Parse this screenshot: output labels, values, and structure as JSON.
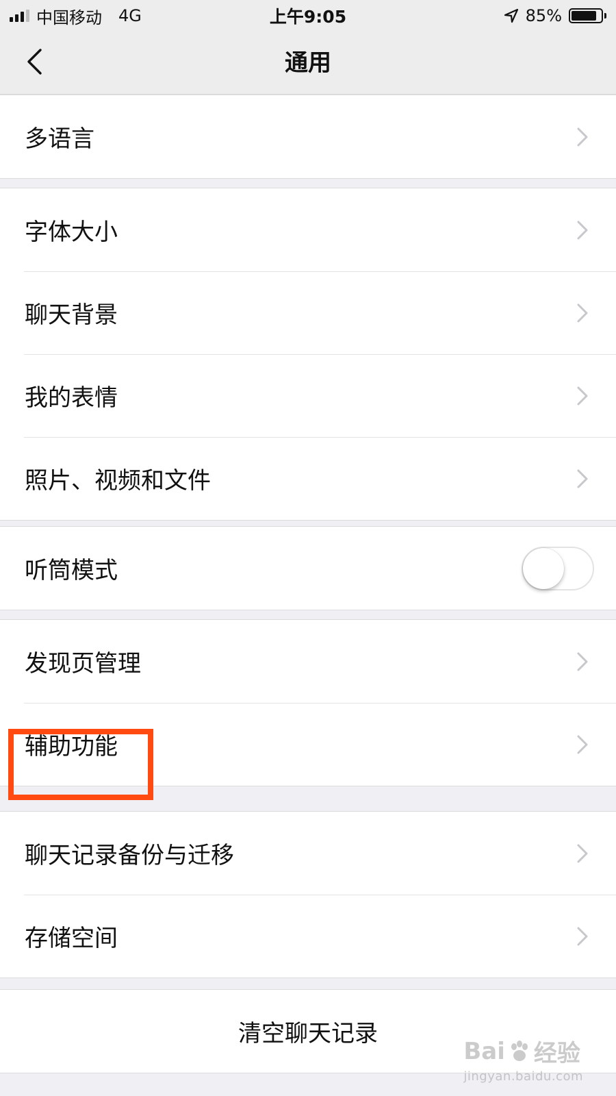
{
  "status_bar": {
    "carrier": "中国移动",
    "network": "4G",
    "time": "上午9:05",
    "battery_percent": "85%",
    "battery_level": 0.85,
    "icons": [
      "signal-icon",
      "location-arrow-icon",
      "battery-icon"
    ]
  },
  "nav": {
    "title": "通用",
    "back_icon": "chevron-left-icon"
  },
  "groups": [
    {
      "items": [
        {
          "label": "多语言",
          "accessory": "chevron-right-icon"
        }
      ]
    },
    {
      "items": [
        {
          "label": "字体大小",
          "accessory": "chevron-right-icon"
        },
        {
          "label": "聊天背景",
          "accessory": "chevron-right-icon"
        },
        {
          "label": "我的表情",
          "accessory": "chevron-right-icon"
        },
        {
          "label": "照片、视频和文件",
          "accessory": "chevron-right-icon"
        }
      ]
    },
    {
      "items": [
        {
          "label": "听筒模式",
          "accessory": "toggle",
          "toggle_on": false
        }
      ]
    },
    {
      "items": [
        {
          "label": "发现页管理",
          "accessory": "chevron-right-icon"
        },
        {
          "label": "辅助功能",
          "accessory": "chevron-right-icon",
          "highlighted": true
        }
      ]
    },
    {
      "items": [
        {
          "label": "聊天记录备份与迁移",
          "accessory": "chevron-right-icon"
        },
        {
          "label": "存储空间",
          "accessory": "chevron-right-icon"
        }
      ]
    },
    {
      "items": [
        {
          "label": "清空聊天记录"
        }
      ]
    }
  ],
  "colors": {
    "highlight": "#ff4a12",
    "background": "#efeff4",
    "chevron": "#c7c7cc"
  },
  "watermark": {
    "logo_text_left": "Bai",
    "logo_text_right": "经验",
    "url": "jingyan.baidu.com"
  }
}
